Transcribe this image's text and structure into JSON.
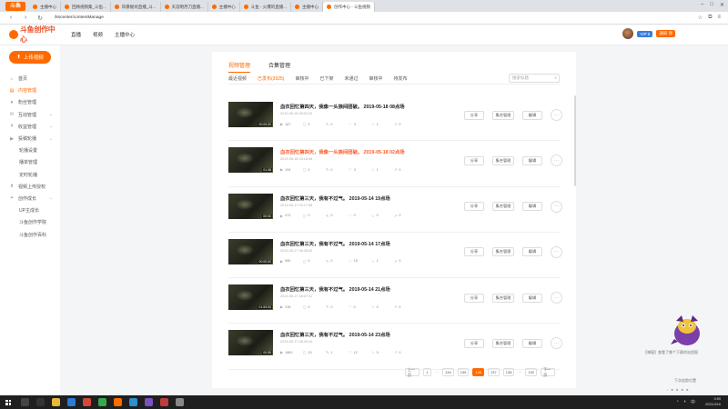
{
  "browser": {
    "tabs": [
      {
        "label": "主播中心"
      },
      {
        "label": "回顾视频集_斗鱼..."
      },
      {
        "label": "风暴掘坑直播_斗..."
      },
      {
        "label": "天涯明月刀直播..."
      },
      {
        "label": "主播中心"
      },
      {
        "label": "斗鱼 - 火爆的直播..."
      },
      {
        "label": "主播中心"
      },
      {
        "label": "创作中心 - 斗鱼视频"
      }
    ],
    "url": "/kscenter/contentManage"
  },
  "site": {
    "logo_text": "斗鱼创作中心",
    "nav": [
      "直播",
      "视频",
      "主播中心"
    ],
    "vip_badge": "VIP 5",
    "promo_badge": "通知 领"
  },
  "sidebar": {
    "upload_label": "上传视频",
    "items": [
      {
        "label": "首页",
        "icon": "⌂",
        "sub": false,
        "active": false,
        "chevron": false
      },
      {
        "label": "内容管理",
        "icon": "▤",
        "sub": false,
        "active": true,
        "chevron": false
      },
      {
        "label": "粉丝管理",
        "icon": "♥",
        "sub": false,
        "active": false,
        "chevron": false
      },
      {
        "label": "互动管理",
        "icon": "✉",
        "sub": false,
        "active": false,
        "chevron": true
      },
      {
        "label": "收益管理",
        "icon": "¥",
        "sub": false,
        "active": false,
        "chevron": true
      },
      {
        "label": "投稿轮播",
        "icon": "▶",
        "sub": false,
        "active": false,
        "chevron": true
      },
      {
        "label": "轮播设置",
        "icon": "",
        "sub": true,
        "active": false,
        "chevron": false
      },
      {
        "label": "播单管理",
        "icon": "",
        "sub": true,
        "active": false,
        "chevron": false
      },
      {
        "label": "定时轮播",
        "icon": "",
        "sub": true,
        "active": false,
        "chevron": false
      },
      {
        "label": "视频上传授权",
        "icon": "⬆",
        "sub": false,
        "active": false,
        "chevron": false
      },
      {
        "label": "创作成长",
        "icon": "✦",
        "sub": false,
        "active": false,
        "chevron": true
      },
      {
        "label": "UP主成长",
        "icon": "",
        "sub": true,
        "active": false,
        "chevron": false
      },
      {
        "label": "斗鱼创作学院",
        "icon": "",
        "sub": true,
        "active": false,
        "chevron": false
      },
      {
        "label": "斗鱼创作百科",
        "icon": "",
        "sub": true,
        "active": false,
        "chevron": false
      }
    ]
  },
  "content": {
    "tabs": [
      {
        "label": "视频管理",
        "active": true
      },
      {
        "label": "合集管理",
        "active": false
      }
    ],
    "filters": [
      {
        "label": "最近视频",
        "active": false
      },
      {
        "label": "已发布(3925)",
        "active": true
      },
      {
        "label": "审核中",
        "active": false
      },
      {
        "label": "已下架",
        "active": false
      },
      {
        "label": "未通过",
        "active": false
      },
      {
        "label": "审核中",
        "active": false
      },
      {
        "label": "待发布",
        "active": false
      }
    ],
    "search_placeholder": "搜索标题",
    "videos": [
      {
        "title": "血衣回忆第四天，我像一头狼间团破。 2019-05-18 08点场",
        "date": "2019-05-18 08:24:23",
        "duration": "00:09:00",
        "highlight": false,
        "stats": [
          "187",
          "0",
          "0",
          "3",
          "1",
          "0"
        ]
      },
      {
        "title": "血衣回忆第四天，我像一头狼间团破。 2019-05-18 02点场",
        "date": "2019-05-18 03:18:46",
        "duration": "01:38",
        "highlight": true,
        "stats": [
          "194",
          "0",
          "0",
          "3",
          "1",
          "0"
        ]
      },
      {
        "title": "血衣回忆第三天，我有不过气。 2019-05-14 19点场",
        "date": "2019-05-17 09:17:08",
        "duration": "00:00",
        "highlight": false,
        "stats": [
          "473",
          "0",
          "0",
          "0",
          "0",
          "0"
        ]
      },
      {
        "title": "血衣回忆第三天，我有不过气。 2019-05-14 17点场",
        "date": "2019-05-17 08:38:42",
        "duration": "00:00:00",
        "highlight": false,
        "stats": [
          "980",
          "0",
          "0",
          "15",
          "1",
          "0"
        ]
      },
      {
        "title": "血衣回忆第三天，我有不过气。 2019-05-14 21点场",
        "date": "2019-05-17 08:07:51",
        "duration": "01:53:00",
        "highlight": false,
        "stats": [
          "238",
          "0",
          "0",
          "0",
          "0",
          "0"
        ]
      },
      {
        "title": "血衣回忆第三天，我有不过气。 2019-05-14 23点场",
        "date": "2019-05-17 08:03:44",
        "duration": "00:55",
        "highlight": false,
        "stats": [
          "1889",
          "15",
          "1",
          "12",
          "5",
          "0"
        ]
      }
    ],
    "actions": {
      "share": "分享",
      "collect": "集合管理",
      "edit": "编辑",
      "more": "···"
    }
  },
  "pagination": {
    "prev": "上一页",
    "pages": [
      "1",
      "···",
      "134",
      "135",
      "136",
      "137",
      "138",
      "···",
      "192"
    ],
    "active": "136",
    "next": "下一页"
  },
  "floating": {
    "notice": "【弹窗】查看了哪个下载的站程图",
    "notice2": "下次追踪位置",
    "notice3": "• ■ ■ ■ ■"
  },
  "taskbar": {
    "time": "0:59",
    "date": "2021/4/16"
  }
}
